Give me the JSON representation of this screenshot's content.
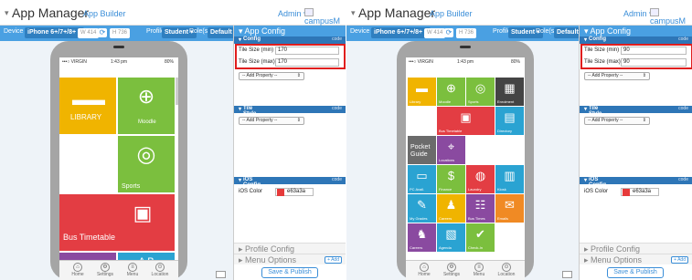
{
  "panels": [
    {
      "header": {
        "title": "App Manager",
        "subtitle": "App Builder",
        "admin": "Admin",
        "entity": "campusM"
      },
      "toolbar": {
        "device_label": "Device",
        "device_value": "iPhone 6+/7+/8+",
        "width_ph": "W 414",
        "height_ph": "H 736",
        "profile_label": "Profile",
        "profile_value": "Student",
        "role_label": "Role(s)",
        "role_value": "Default"
      },
      "phone": {
        "status": {
          "carrier": "•••○ VIRGIN",
          "time": "1:43 pm",
          "battery": "80%"
        },
        "tiles": [
          {
            "label": "LIBRARY",
            "icon": "library-icon",
            "color": "#f0b400"
          },
          {
            "label": "Moodle",
            "icon": "cursor-icon",
            "color": "#7bbf3e"
          },
          {
            "label": "Sports",
            "icon": "sports-icon",
            "color": "#7bbf3e"
          },
          {
            "label": "Bus Timetable",
            "icon": "bus-icon",
            "color": "#e33d43"
          },
          {
            "label": "",
            "icon": "person-board-icon",
            "color": "#8a4aa0"
          },
          {
            "label": "",
            "icon": "abc-board-icon",
            "color": "#2aa3d2"
          }
        ],
        "dock": [
          {
            "label": "Home"
          },
          {
            "label": "Settings"
          },
          {
            "label": "Menu"
          },
          {
            "label": "Location"
          }
        ]
      },
      "config": {
        "app_config_title": "App Config",
        "config_label": "Config",
        "code_label": "code",
        "min_label": "Tile Size (min)",
        "min_value": "170",
        "max_label": "Tile Size (max)",
        "max_value": "170",
        "add_property": "-- Add Property --",
        "tile_style_label": "Tile Style",
        "ios_config_label": "iOS Config",
        "ios_color_label": "iOS Color",
        "ios_color_value": "e63a3a",
        "profile_config": "Profile Config",
        "menu_options": "Menu Options",
        "add_label": "+ Add",
        "save_label": "Save & Publish"
      }
    },
    {
      "header": {
        "title": "App Manager",
        "subtitle": "App Builder",
        "admin": "Admin",
        "entity": "campusM"
      },
      "toolbar": {
        "device_label": "Device",
        "device_value": "iPhone 6+/7+/8+",
        "width_ph": "W 414",
        "height_ph": "H 736",
        "profile_label": "Profile",
        "profile_value": "Student",
        "role_label": "Role(s)",
        "role_value": "Default"
      },
      "phone": {
        "status": {
          "carrier": "•••○ VIRGIN",
          "time": "1:43 pm",
          "battery": "80%"
        },
        "tiles": [
          {
            "label": "Library",
            "icon": "library-icon",
            "color": "#f0b400"
          },
          {
            "label": "Moodle",
            "icon": "cursor-icon",
            "color": "#7bbf3e"
          },
          {
            "label": "Sports",
            "icon": "sports-icon",
            "color": "#7bbf3e"
          },
          {
            "label": "Enrolment",
            "icon": "enrolment-icon",
            "color": "#444444"
          },
          {
            "label": "Bus Timetable",
            "icon": "bus-icon",
            "color": "#e33d43"
          },
          {
            "label": "Directory",
            "icon": "directory-icon",
            "color": "#2aa3d2"
          },
          {
            "label": "Pocket Guide",
            "icon": "",
            "color": "#6b6b6b"
          },
          {
            "label": "Locations",
            "icon": "location-icon",
            "color": "#8a4aa0"
          },
          {
            "label": "PC Avail.",
            "icon": "pc-icon",
            "color": "#2aa3d2"
          },
          {
            "label": "Finance",
            "icon": "finance-icon",
            "color": "#7bbf3e"
          },
          {
            "label": "Laundry",
            "icon": "laundry-icon",
            "color": "#e33d43"
          },
          {
            "label": "Kiosk",
            "icon": "kiosk-icon",
            "color": "#2aa3d2"
          },
          {
            "label": "My Grades",
            "icon": "grades-icon",
            "color": "#2aa3d2"
          },
          {
            "label": "Careers",
            "icon": "careers-icon",
            "color": "#f0b400"
          },
          {
            "label": "Bus Times",
            "icon": "bus-times-icon",
            "color": "#8a4aa0"
          },
          {
            "label": "Emails",
            "icon": "email-icon",
            "color": "#f08a24"
          },
          {
            "label": "Careers",
            "icon": "careers2-icon",
            "color": "#8a4aa0"
          },
          {
            "label": "Agenda",
            "icon": "agenda-icon",
            "color": "#2aa3d2"
          },
          {
            "label": "Check-In",
            "icon": "check-icon",
            "color": "#7bbf3e"
          }
        ],
        "dock": [
          {
            "label": "Home"
          },
          {
            "label": "Settings"
          },
          {
            "label": "Menu"
          },
          {
            "label": "Location"
          }
        ]
      },
      "config": {
        "app_config_title": "App Config",
        "config_label": "Config",
        "code_label": "code",
        "min_label": "Tile Size (min)",
        "min_value": "90",
        "max_label": "Tile Size (max)",
        "max_value": "90",
        "add_property": "-- Add Property --",
        "tile_style_label": "Tile Style",
        "ios_config_label": "iOS Config",
        "ios_color_label": "iOS Color",
        "ios_color_value": "e63a3a",
        "profile_config": "Profile Config",
        "menu_options": "Menu Options",
        "add_label": "+ Add",
        "save_label": "Save & Publish"
      }
    }
  ]
}
